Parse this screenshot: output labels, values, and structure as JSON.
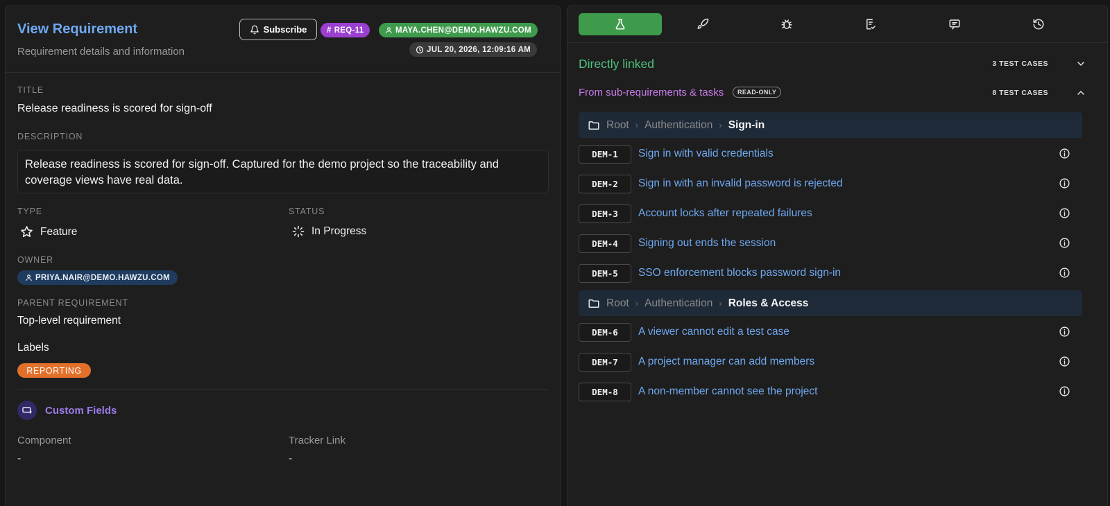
{
  "header": {
    "title": "View Requirement",
    "subtitle": "Requirement details and information",
    "subscribe_label": "Subscribe",
    "req_badge": "REQ-11",
    "assignee_badge": "MAYA.CHEN@DEMO.HAWZU.COM",
    "date_badge": "JUL 20, 2026, 12:09:16 AM"
  },
  "details": {
    "title_label": "TITLE",
    "title_value": "Release readiness is scored for sign-off",
    "description_label": "DESCRIPTION",
    "description_value": "Release readiness is scored for sign-off. Captured for the demo project so the traceability and coverage views have real data.",
    "type_label": "TYPE",
    "type_value": "Feature",
    "status_label": "STATUS",
    "status_value": "In Progress",
    "owner_label": "OWNER",
    "owner_value": "PRIYA.NAIR@DEMO.HAWZU.COM",
    "parent_label": "PARENT REQUIREMENT",
    "parent_value": "Top-level requirement",
    "labels_heading": "Labels",
    "labels": [
      "REPORTING"
    ]
  },
  "custom_fields": {
    "title": "Custom Fields",
    "fields": [
      {
        "label": "Component",
        "value": "-"
      },
      {
        "label": "Tracker Link",
        "value": "-"
      }
    ]
  },
  "tabs": [
    {
      "icon": "flask-icon",
      "active": true
    },
    {
      "icon": "rocket-icon",
      "active": false
    },
    {
      "icon": "bug-icon",
      "active": false
    },
    {
      "icon": "clipboard-check-icon",
      "active": false
    },
    {
      "icon": "message-icon",
      "active": false
    },
    {
      "icon": "history-icon",
      "active": false
    }
  ],
  "linked": {
    "direct_title": "Directly linked",
    "direct_count": "3 TEST CASES",
    "sub_title": "From sub-requirements & tasks",
    "readonly_label": "READ-ONLY",
    "sub_count": "8 TEST CASES",
    "groups": [
      {
        "path": [
          "Root",
          "Authentication"
        ],
        "current": "Sign-in",
        "cases": [
          {
            "id": "DEM-1",
            "title": "Sign in with valid credentials"
          },
          {
            "id": "DEM-2",
            "title": "Sign in with an invalid password is rejected"
          },
          {
            "id": "DEM-3",
            "title": "Account locks after repeated failures"
          },
          {
            "id": "DEM-4",
            "title": "Signing out ends the session"
          },
          {
            "id": "DEM-5",
            "title": "SSO enforcement blocks password sign-in"
          }
        ]
      },
      {
        "path": [
          "Root",
          "Authentication"
        ],
        "current": "Roles & Access",
        "cases": [
          {
            "id": "DEM-6",
            "title": "A viewer cannot edit a test case"
          },
          {
            "id": "DEM-7",
            "title": "A project manager can add members"
          },
          {
            "id": "DEM-8",
            "title": "A non-member cannot see the project"
          }
        ]
      }
    ]
  },
  "colors": {
    "accent_blue": "#6ea8f0",
    "green": "#3f9b4c",
    "purple": "#9b3fd1",
    "orange": "#e3702a"
  }
}
